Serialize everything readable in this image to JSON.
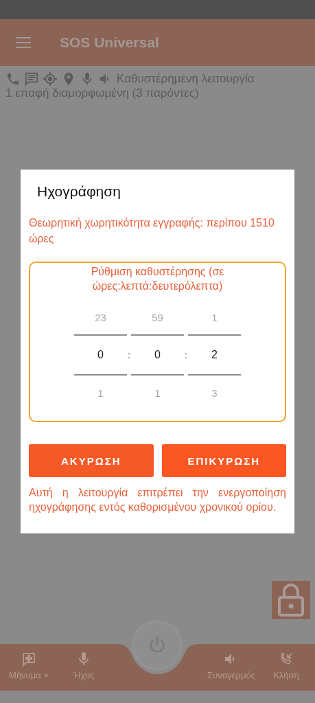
{
  "app_bar": {
    "title": "SOS Universal"
  },
  "status_line": {
    "mode": "Καθυστέρημενη λειτουργία",
    "contacts": "1 επαφή διαμορφωμένη (3 παρόντες)"
  },
  "dialog": {
    "title": "Ηχογράφηση",
    "capacity": "Θεωρητική χωρητικότητα εγγραφής: περίπου 1510 ώρες",
    "picker": {
      "label": "Ρύθμιση καθυστέρησης (σε ώρες:λεπτά:δευτερόλεπτα)",
      "separator": ":",
      "columns": [
        {
          "above": "23",
          "value": "0",
          "below": "1"
        },
        {
          "above": "59",
          "value": "0",
          "below": "1"
        },
        {
          "above": "1",
          "value": "2",
          "below": "3"
        }
      ]
    },
    "buttons": [
      {
        "label": "ΑΚΥΡΩΣΗ",
        "kind": "cancel"
      },
      {
        "label": "ΕΠΙΚΥΡΩΣΗ",
        "kind": "confirm"
      }
    ],
    "note": "Αυτή η λειτουργία επιτρέπει την ενεργοποίηση ηχογράφησης εντός καθορισμένου χρονικού ορίου."
  },
  "bottom_nav": [
    {
      "label": "Μήνυμα +",
      "kind": "message"
    },
    {
      "label": "Ήχος",
      "kind": "mic"
    },
    {
      "label": "Συναγερμός",
      "kind": "alarm"
    },
    {
      "label": "Κλήση",
      "kind": "call"
    }
  ]
}
